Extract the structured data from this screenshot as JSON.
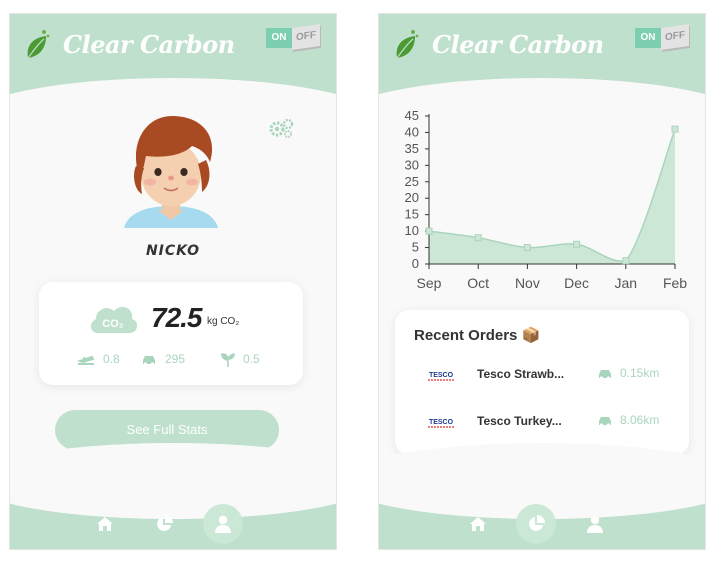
{
  "app": {
    "brand": "Clear Carbon",
    "toggle": {
      "on_label": "ON",
      "off_label": "OFF"
    }
  },
  "profile_screen": {
    "username": "NICKO",
    "emission": {
      "value": "72.5",
      "unit": "kg CO₂",
      "cloud_label": "CO₂"
    },
    "metrics": [
      {
        "icon": "plane-icon",
        "value": "0.8"
      },
      {
        "icon": "car-icon",
        "value": "295"
      },
      {
        "icon": "plant-icon",
        "value": "0.5"
      }
    ],
    "see_full_stats_label": "See Full Stats",
    "nav": [
      {
        "icon": "home-icon",
        "active": false
      },
      {
        "icon": "pie-chart-icon",
        "active": false
      },
      {
        "icon": "user-icon",
        "active": true
      }
    ]
  },
  "stats_screen": {
    "chart_data": {
      "type": "area",
      "categories": [
        "Sep",
        "Oct",
        "Nov",
        "Dec",
        "Jan",
        "Feb"
      ],
      "series": [
        {
          "values": [
            10,
            8,
            5,
            6,
            1,
            41
          ]
        }
      ],
      "yticks": [
        0,
        5,
        10,
        15,
        20,
        25,
        30,
        35,
        40,
        45
      ],
      "ylim": [
        0,
        45
      ],
      "grid": false
    },
    "recent_orders_title": "Recent Orders 📦",
    "orders": [
      {
        "store": "TESCO",
        "name": "Tesco Strawb...",
        "distance": "0.15km"
      },
      {
        "store": "TESCO",
        "name": "Tesco Turkey...",
        "distance": "8.06km"
      }
    ],
    "nav": [
      {
        "icon": "home-icon",
        "active": false
      },
      {
        "icon": "pie-chart-icon",
        "active": true
      },
      {
        "icon": "user-icon",
        "active": false
      }
    ]
  },
  "colors": {
    "accent": "#bfe0cc",
    "accent_dark": "#a9d5bc",
    "toggle_on": "#7bcfae",
    "chart_fill": "#cde7d6",
    "chart_line": "#a9d5bc"
  }
}
